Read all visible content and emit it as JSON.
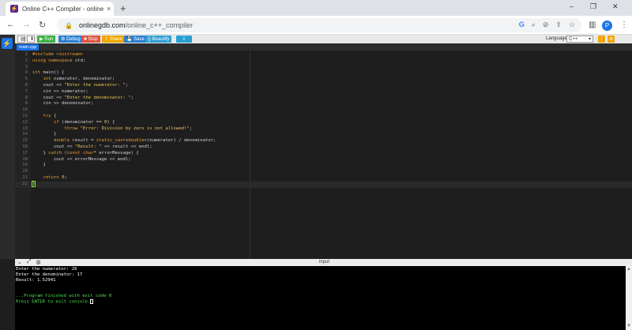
{
  "browser": {
    "tab_title": "Online C++ Compiler - online e",
    "new_tab": "+",
    "tab_close": "×",
    "url_host": "onlinegdb.com",
    "url_path": "/online_c++_compiler",
    "profile_initial": "P",
    "window_minimize": "–",
    "window_restore": "❐",
    "window_close": "✕"
  },
  "toolbar": {
    "run_label": "▶ Run",
    "debug_label": "⚙ Debug",
    "stop_label": "■ Stop",
    "share_label": "⇪ Share",
    "save_label": "💾 Save",
    "beautify_label": "{} Beautify",
    "download_label": "⤓",
    "language_label": "Language",
    "language_value": "C++"
  },
  "file_tab": "main.cpp",
  "code_lines": [
    {
      "n": "1",
      "html": "<span class=\"pp\">#include &lt;iostream&gt;</span>"
    },
    {
      "n": "2",
      "html": "<span class=\"kw\">using namespace</span> std;"
    },
    {
      "n": "3",
      "html": ""
    },
    {
      "n": "4",
      "html": "<span class=\"kw\">int</span> main() {"
    },
    {
      "n": "5",
      "html": "    <span class=\"kw\">int</span> numerator, denominator;"
    },
    {
      "n": "6",
      "html": "    cout &lt;&lt; <span class=\"st\">\"Enter the numerator: \"</span>;"
    },
    {
      "n": "7",
      "html": "    cin &gt;&gt; numerator;"
    },
    {
      "n": "8",
      "html": "    cout &lt;&lt; <span class=\"st\">\"Enter the denominator: \"</span>;"
    },
    {
      "n": "9",
      "html": "    cin &gt;&gt; denominator;"
    },
    {
      "n": "10",
      "html": ""
    },
    {
      "n": "11",
      "html": "    <span class=\"kw\">try</span> {"
    },
    {
      "n": "12",
      "html": "        <span class=\"kw\">if</span> (denominator == <span class=\"st\">0</span>) {"
    },
    {
      "n": "13",
      "html": "            <span class=\"kw\">throw</span> <span class=\"st\">\"Error: Division by zero is not allowed!\"</span>;"
    },
    {
      "n": "14",
      "html": "        }"
    },
    {
      "n": "15",
      "html": "        <span class=\"kw\">double</span> result = <span class=\"kw\">static_cast</span>&lt;<span class=\"kw\">double</span>&gt;(numerator) / denominator;"
    },
    {
      "n": "16",
      "html": "        cout &lt;&lt; <span class=\"st\">\"Result: \"</span> &lt;&lt; result &lt;&lt; endl;"
    },
    {
      "n": "17",
      "html": "    } <span class=\"kw\">catch</span> (<span class=\"kw\">const char</span>* errorMessage) {"
    },
    {
      "n": "18",
      "html": "        cout &lt;&lt; errorMessage &lt;&lt; endl;"
    },
    {
      "n": "19",
      "html": "    }"
    },
    {
      "n": "20",
      "html": ""
    },
    {
      "n": "21",
      "html": "    <span class=\"kw\">return</span> <span class=\"st\">0</span>;"
    },
    {
      "n": "22",
      "html": "<span class=\"brace-hl\">}</span>"
    }
  ],
  "io": {
    "title": "input",
    "lines": [
      "Enter the numerator: 26",
      "Enter the denominator: 17",
      "Result: 1.52941",
      "",
      ""
    ],
    "finish_line": "...Program finished with exit code 0",
    "press_enter": "Press ENTER to exit console."
  }
}
